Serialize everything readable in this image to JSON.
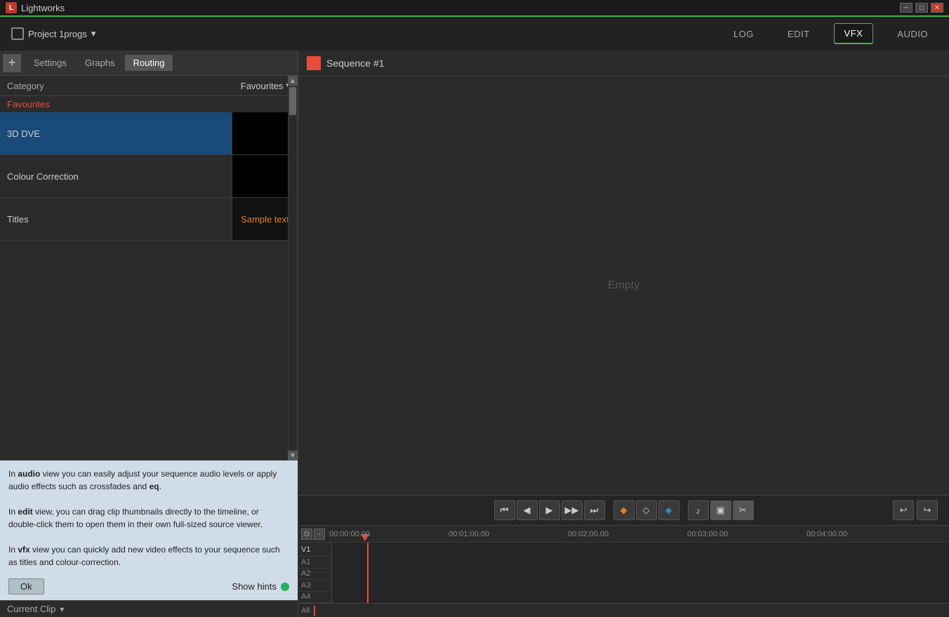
{
  "app": {
    "title": "Lightworks",
    "icon": "L"
  },
  "window_controls": {
    "minimize": "─",
    "maximize": "□",
    "close": "✕"
  },
  "nav": {
    "project_name": "Project 1progs",
    "dropdown_arrow": "▾",
    "tabs": [
      {
        "id": "log",
        "label": "LOG",
        "active": false
      },
      {
        "id": "edit",
        "label": "EDIT",
        "active": false
      },
      {
        "id": "vfx",
        "label": "VFX",
        "active": true
      },
      {
        "id": "audio",
        "label": "AUDIO",
        "active": false
      }
    ]
  },
  "sub_tabs": {
    "plus": "+",
    "tabs": [
      {
        "id": "settings",
        "label": "Settings",
        "active": false
      },
      {
        "id": "graphs",
        "label": "Graphs",
        "active": false
      },
      {
        "id": "routing",
        "label": "Routing",
        "active": true
      }
    ]
  },
  "effects": {
    "category_label": "Category",
    "category_value": "Favourites",
    "category_arrow": "▾",
    "favourites_label": "Favourites",
    "items": [
      {
        "id": "3d-dve",
        "name": "3D DVE",
        "selected": true,
        "thumb_type": "black"
      },
      {
        "id": "colour-correction",
        "name": "Colour Correction",
        "selected": false,
        "thumb_type": "black"
      },
      {
        "id": "titles",
        "name": "Titles",
        "selected": false,
        "thumb_type": "sample",
        "thumb_label": "Sample text"
      }
    ]
  },
  "hint_box": {
    "paragraph1_prefix": "In ",
    "paragraph1_bold": "audio",
    "paragraph1_text": " view you can easily adjust your sequence audio levels or apply audio effects such as crossfades and ",
    "paragraph1_bold2": "eq",
    "paragraph1_end": ".",
    "paragraph2_prefix": "In ",
    "paragraph2_bold": "edit",
    "paragraph2_text": " view, you can drag clip thumbnails directly to the timeline, or double-click them to open them in their own full-sized source viewer.",
    "paragraph3_prefix": "In ",
    "paragraph3_bold": "vfx",
    "paragraph3_text": " view you can quickly add new video effects to your sequence such as titles and colour-correction.",
    "ok_label": "Ok",
    "show_hints_label": "Show hints"
  },
  "current_clip": {
    "label": "Current Clip",
    "arrow": "▾"
  },
  "viewer": {
    "sequence_title": "Sequence #1",
    "empty_label": "Empty"
  },
  "transport": {
    "buttons": [
      {
        "id": "go-start",
        "symbol": "⏮",
        "type": "normal"
      },
      {
        "id": "prev-frame",
        "symbol": "◀",
        "type": "normal"
      },
      {
        "id": "play",
        "symbol": "▶",
        "type": "normal"
      },
      {
        "id": "next-frame",
        "symbol": "▶",
        "type": "normal"
      },
      {
        "id": "go-end",
        "symbol": "⏭",
        "type": "normal"
      },
      {
        "id": "mark-in",
        "symbol": "◆",
        "type": "orange"
      },
      {
        "id": "mark-out",
        "symbol": "◇",
        "type": "normal"
      },
      {
        "id": "mark-clip",
        "symbol": "◈",
        "type": "blue"
      },
      {
        "id": "audio-toggle",
        "symbol": "♪",
        "type": "normal"
      },
      {
        "id": "insert",
        "symbol": "▣",
        "type": "special"
      },
      {
        "id": "overwrite",
        "symbol": "✂",
        "type": "special"
      }
    ],
    "undo": "↩",
    "redo": "↪"
  },
  "timeline": {
    "time_marks": [
      {
        "label": "00:00:00.00",
        "pos": 50
      },
      {
        "label": "00:01:00.00",
        "pos": 220
      },
      {
        "label": "00:02:00.00",
        "pos": 390
      },
      {
        "label": "00:03:00.00",
        "pos": 560
      },
      {
        "label": "00:04:00.00",
        "pos": 730
      }
    ],
    "tracks": [
      {
        "id": "v1",
        "label": "V1",
        "type": "video"
      },
      {
        "id": "a1",
        "label": "A1",
        "type": "audio"
      },
      {
        "id": "a2",
        "label": "A2",
        "type": "audio"
      },
      {
        "id": "a3",
        "label": "A3",
        "type": "audio"
      },
      {
        "id": "a4",
        "label": "A4",
        "type": "audio"
      }
    ],
    "all_label": "All"
  },
  "colors": {
    "accent_green": "#4caf50",
    "accent_red": "#e74c3c",
    "accent_orange": "#e67e22",
    "accent_blue": "#3498db",
    "selected_blue": "#1a4a7a",
    "bg_dark": "#2b2b2b",
    "bg_darker": "#222"
  }
}
